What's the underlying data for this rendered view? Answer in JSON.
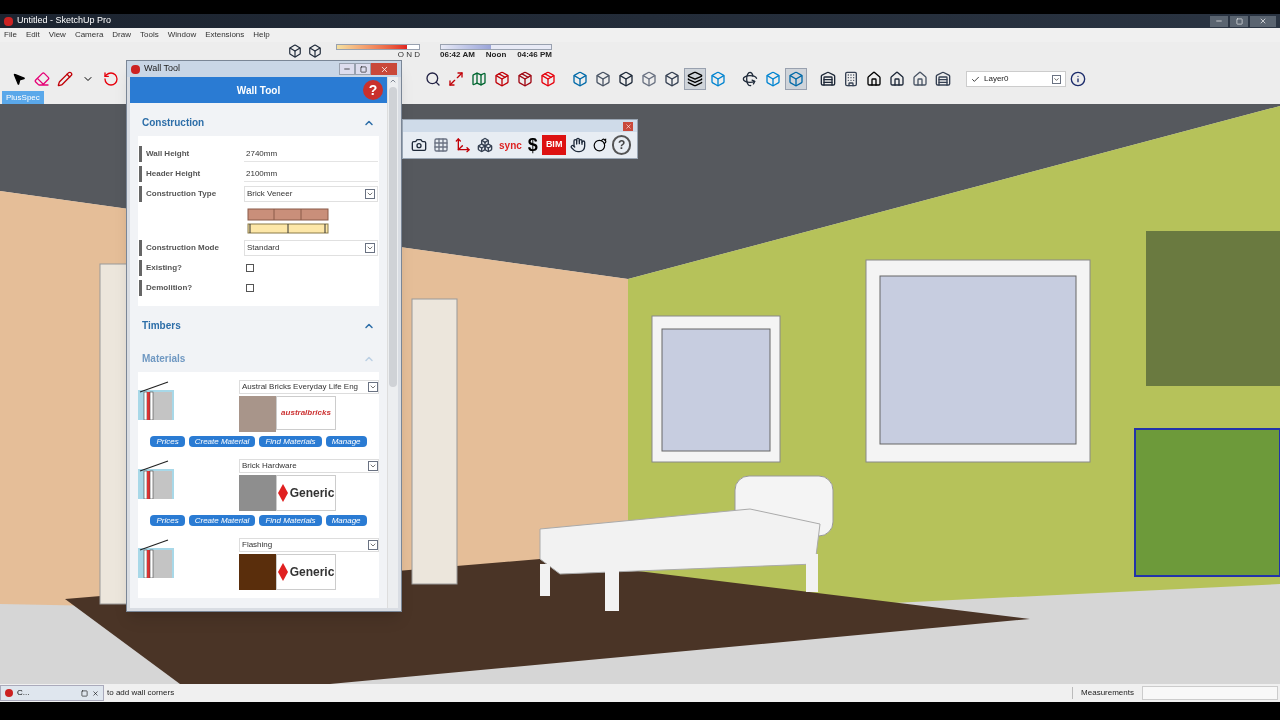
{
  "window": {
    "title": "Untitled - SketchUp Pro"
  },
  "menu": [
    "File",
    "Edit",
    "View",
    "Camera",
    "Draw",
    "Tools",
    "Window",
    "Extensions",
    "Help"
  ],
  "shadow_toolbar": {
    "month_slider": {
      "level": 0.85,
      "labels": "O N D"
    },
    "time_slider": {
      "level": 0.45,
      "labels": [
        "06:42 AM",
        "Noon",
        "04:46 PM"
      ]
    }
  },
  "layer": "Layer0",
  "ribbon_tab": {
    "label": "PlusSpec",
    "selected": true
  },
  "plugin_toolbar": [
    {
      "kind": "sync",
      "label": "sync"
    },
    {
      "kind": "dollar",
      "label": "$"
    },
    {
      "kind": "bim",
      "label": "BIM"
    },
    {
      "kind": "help",
      "label": "?"
    }
  ],
  "wall_tool": {
    "title": "Wall Tool",
    "header": "Wall Tool",
    "help": "?",
    "sections": [
      {
        "title": "Construction",
        "disabled": false,
        "fields": [
          {
            "kind": "text",
            "label": "Wall Height",
            "value": "2740mm"
          },
          {
            "kind": "text",
            "label": "Header Height",
            "value": "2100mm"
          },
          {
            "kind": "select_preview",
            "label": "Construction Type",
            "value": "Brick Veneer"
          },
          {
            "kind": "select",
            "label": "Construction Mode",
            "value": "Standard"
          },
          {
            "kind": "checkbox",
            "label": "Existing?",
            "checked": false
          },
          {
            "kind": "checkbox",
            "label": "Demolition?",
            "checked": false
          }
        ]
      },
      {
        "title": "Timbers",
        "disabled": false
      },
      {
        "title": "Materials",
        "disabled": true,
        "materials": [
          {
            "name": "Austral Bricks Everyday Life Eng",
            "color": "#a8958a",
            "logo": {
              "kind": "brand",
              "text": "australbricks"
            },
            "buttons": [
              "Prices",
              "Create Material",
              "Find Materials",
              "Manage"
            ]
          },
          {
            "name": "Brick Hardware",
            "color": "#8e8e8e",
            "logo": {
              "kind": "generic",
              "text": "Generic"
            },
            "buttons": [
              "Prices",
              "Create Material",
              "Find Materials",
              "Manage"
            ]
          },
          {
            "name": "Flashing",
            "color": "#5a2e0c",
            "logo": {
              "kind": "generic",
              "text": "Generic"
            }
          }
        ]
      }
    ]
  },
  "status_bar": {
    "minimized": "C...",
    "hint": "to add wall corners",
    "measurements_label": "Measurements"
  }
}
